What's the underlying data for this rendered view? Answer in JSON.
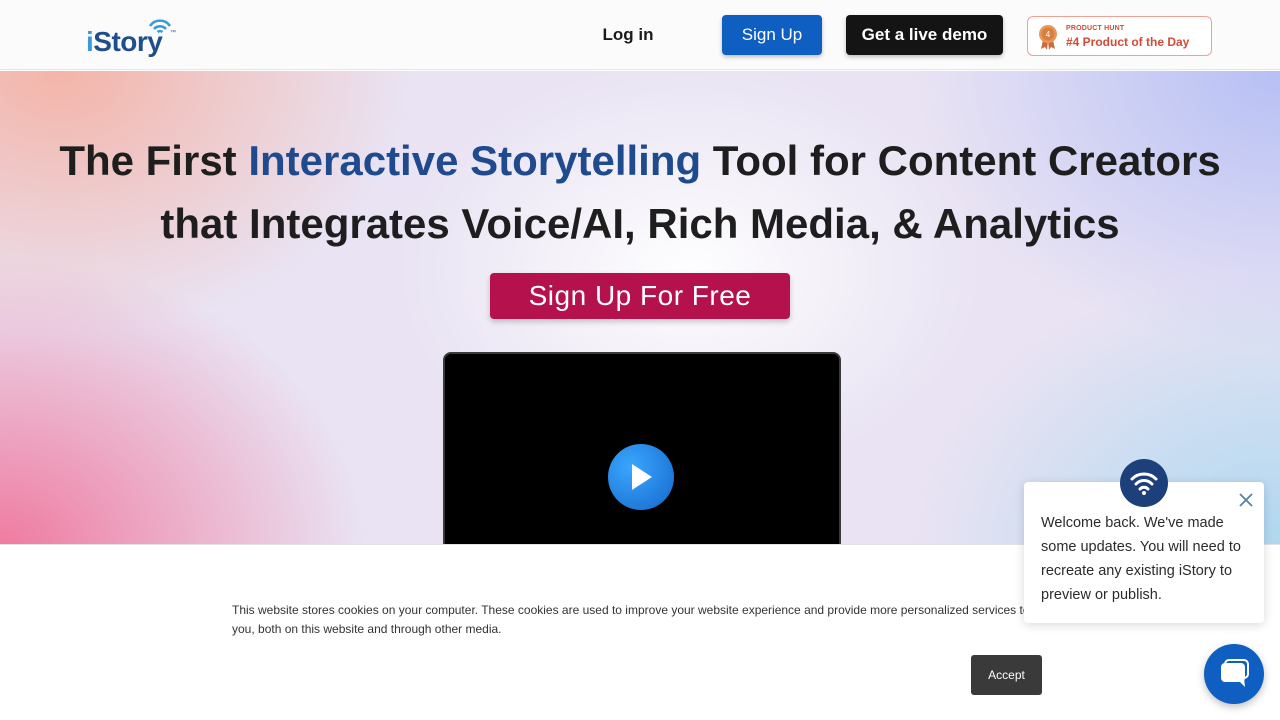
{
  "header": {
    "logo": {
      "text_i": "i",
      "text_rest": "Story",
      "tm": "™"
    },
    "nav": {
      "login": "Log in",
      "signup": "Sign Up",
      "demo": "Get a live demo"
    },
    "product_hunt": {
      "rank": "4",
      "label_small": "PRODUCT HUNT",
      "label_big": "#4 Product of the Day"
    }
  },
  "hero": {
    "title_part1": "The First ",
    "title_accent": "Interactive Storytelling",
    "title_part2": " Tool for Content Creators",
    "title_line2": "that Integrates Voice/AI, Rich Media, & Analytics",
    "cta": "Sign Up For Free"
  },
  "cookie_banner": {
    "text": "This website stores cookies on your computer. These cookies are used to improve your website experience and provide more personalized services to you, both on this website and through other media.",
    "accept": "Accept"
  },
  "chat": {
    "message": "Welcome back. We've made some updates. You will need to recreate any existing iStory to preview or publish."
  },
  "colors": {
    "brand_blue": "#0f5ec2",
    "title_accent": "#1f4a8e",
    "cta_crimson": "#b5114d",
    "product_hunt": "#d24a34"
  },
  "icons": [
    "wifi-waves-icon",
    "medal-icon",
    "play-icon",
    "close-icon",
    "chat-bubble-icon"
  ]
}
